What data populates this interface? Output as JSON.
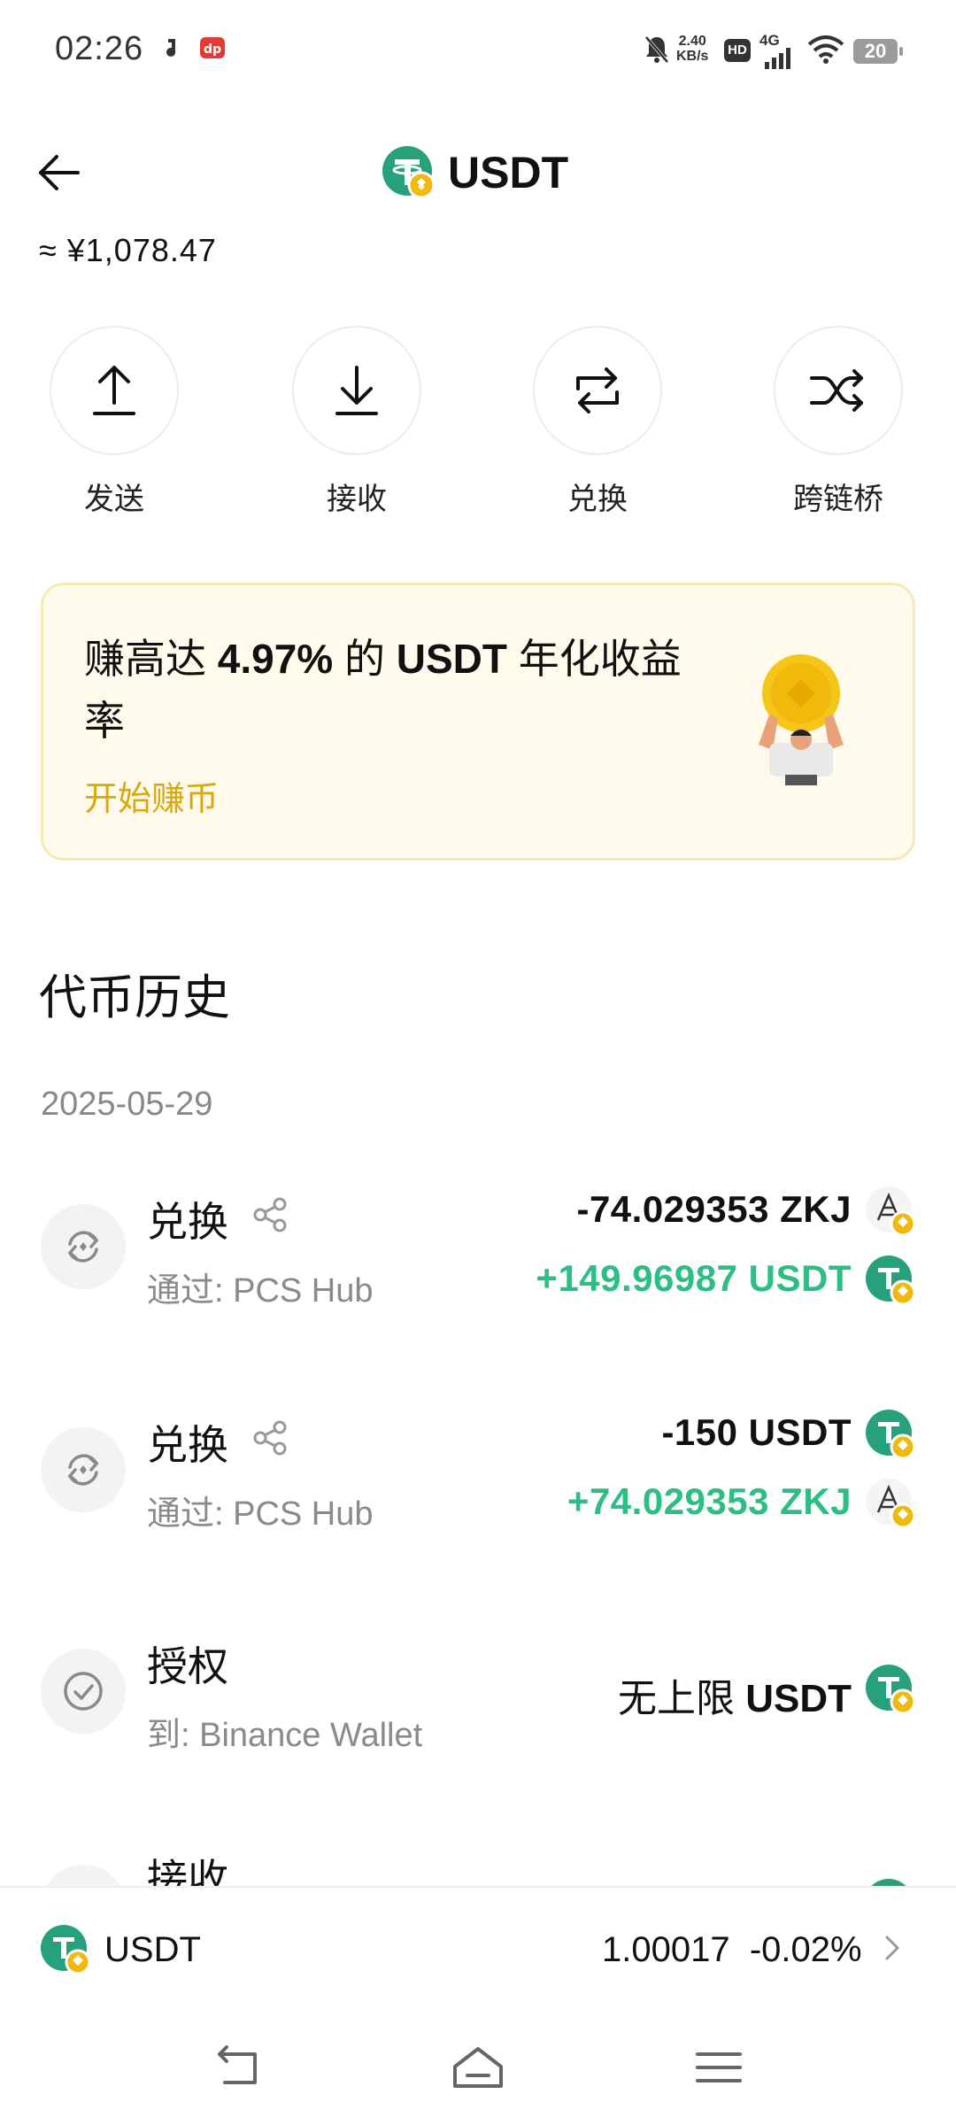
{
  "status_bar": {
    "time": "02:26",
    "net_speed_top": "2.40",
    "net_speed_bottom": "KB/s",
    "hd": "HD",
    "network": "4G",
    "battery": "20"
  },
  "header": {
    "title": "USDT",
    "fiat_value": "≈ ¥1,078.47"
  },
  "actions": [
    {
      "label": "发送",
      "icon": "upload-icon"
    },
    {
      "label": "接收",
      "icon": "download-icon"
    },
    {
      "label": "兑换",
      "icon": "swap-icon"
    },
    {
      "label": "跨链桥",
      "icon": "shuffle-icon"
    }
  ],
  "promo": {
    "text_prefix": "赚高达 ",
    "rate": "4.97%",
    "text_mid": " 的 ",
    "token": "USDT",
    "text_suffix": " 年化收益率",
    "cta": "开始赚币"
  },
  "history": {
    "title": "代币历史",
    "date": "2025-05-29",
    "items": [
      {
        "type": "兑换",
        "sub": "通过: PCS Hub",
        "amount_out": "-74.029353 ZKJ",
        "amount_in": "+149.96987 USDT"
      },
      {
        "type": "兑换",
        "sub": "通过: PCS Hub",
        "amount_out": "-150 USDT",
        "amount_in": "+74.029353 ZKJ"
      },
      {
        "type": "授权",
        "sub": "到: Binance Wallet",
        "amount_prefix": "无上限 ",
        "amount_token": "USDT"
      },
      {
        "type": "接收"
      }
    ]
  },
  "bottom_bar": {
    "token": "USDT",
    "price": "1.00017",
    "change": "-0.02%"
  },
  "colors": {
    "positive": "#2ebd85",
    "accent_gold": "#d9a80c",
    "usdt_teal": "#26a17b",
    "bnb_badge": "#f0b90b"
  }
}
